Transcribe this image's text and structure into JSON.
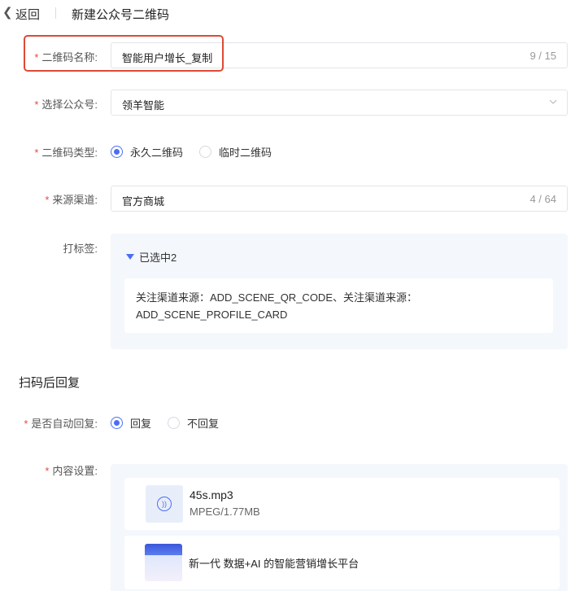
{
  "header": {
    "back_label": "返回",
    "title": "新建公众号二维码"
  },
  "form": {
    "name": {
      "label": "二维码名称:",
      "value": "智能用户增长_复制",
      "count": "9 / 15"
    },
    "account": {
      "label": "选择公众号:",
      "value": "领羊智能"
    },
    "qr_type": {
      "label": "二维码类型:",
      "options": [
        "永久二维码",
        "临时二维码"
      ],
      "selected": "永久二维码"
    },
    "channel": {
      "label": "来源渠道:",
      "value": "官方商城",
      "count": "4 / 64"
    },
    "tags": {
      "label": "打标签:",
      "toggle_label": "已选中2",
      "content_line1": "关注渠道来源：ADD_SCENE_QR_CODE、关注渠道来源：",
      "content_line2": "ADD_SCENE_PROFILE_CARD"
    }
  },
  "reply_section": {
    "title": "扫码后回复",
    "auto_reply": {
      "label": "是否自动回复:",
      "options": [
        "回复",
        "不回复"
      ],
      "selected": "回复"
    },
    "content": {
      "label": "内容设置:",
      "items": [
        {
          "kind": "audio",
          "name": "45s.mp3",
          "meta": "MPEG/1.77MB",
          "icon": "audio-icon"
        },
        {
          "kind": "article",
          "title": "新一代 数据+AI 的智能营销增长平台",
          "icon": "article-thumbnail"
        }
      ]
    }
  },
  "colors": {
    "accent": "#4b6ef5",
    "required": "#e84a3c",
    "highlight": "#dd4a35",
    "panel_bg": "#f4f7fc"
  }
}
